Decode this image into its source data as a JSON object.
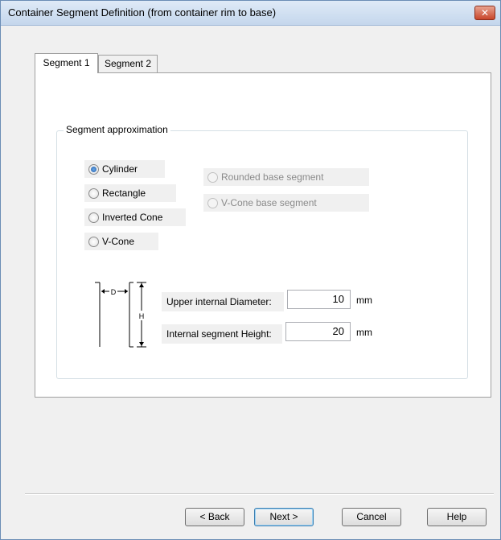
{
  "window": {
    "title": "Container Segment Definition (from container rim to base)",
    "close_label": "✕"
  },
  "tabs": [
    {
      "label": "Segment 1",
      "active": true
    },
    {
      "label": "Segment 2",
      "active": false
    }
  ],
  "group": {
    "title": "Segment approximation",
    "options": [
      {
        "label": "Cylinder",
        "checked": true,
        "enabled": true
      },
      {
        "label": "Rectangle",
        "checked": false,
        "enabled": true
      },
      {
        "label": "Inverted Cone",
        "checked": false,
        "enabled": true
      },
      {
        "label": "V-Cone",
        "checked": false,
        "enabled": true
      }
    ],
    "base_options": [
      {
        "label": "Rounded base segment",
        "checked": false,
        "enabled": false
      },
      {
        "label": "V-Cone base segment",
        "checked": false,
        "enabled": false
      }
    ]
  },
  "diagram": {
    "d_label": "D",
    "h_label": "H"
  },
  "fields": {
    "upper_diameter": {
      "label": "Upper internal Diameter:",
      "value": "10",
      "unit": "mm"
    },
    "segment_height": {
      "label": "Internal segment Height:",
      "value": "20",
      "unit": "mm"
    }
  },
  "buttons": {
    "back": "< Back",
    "next": "Next >",
    "cancel": "Cancel",
    "help": "Help"
  }
}
